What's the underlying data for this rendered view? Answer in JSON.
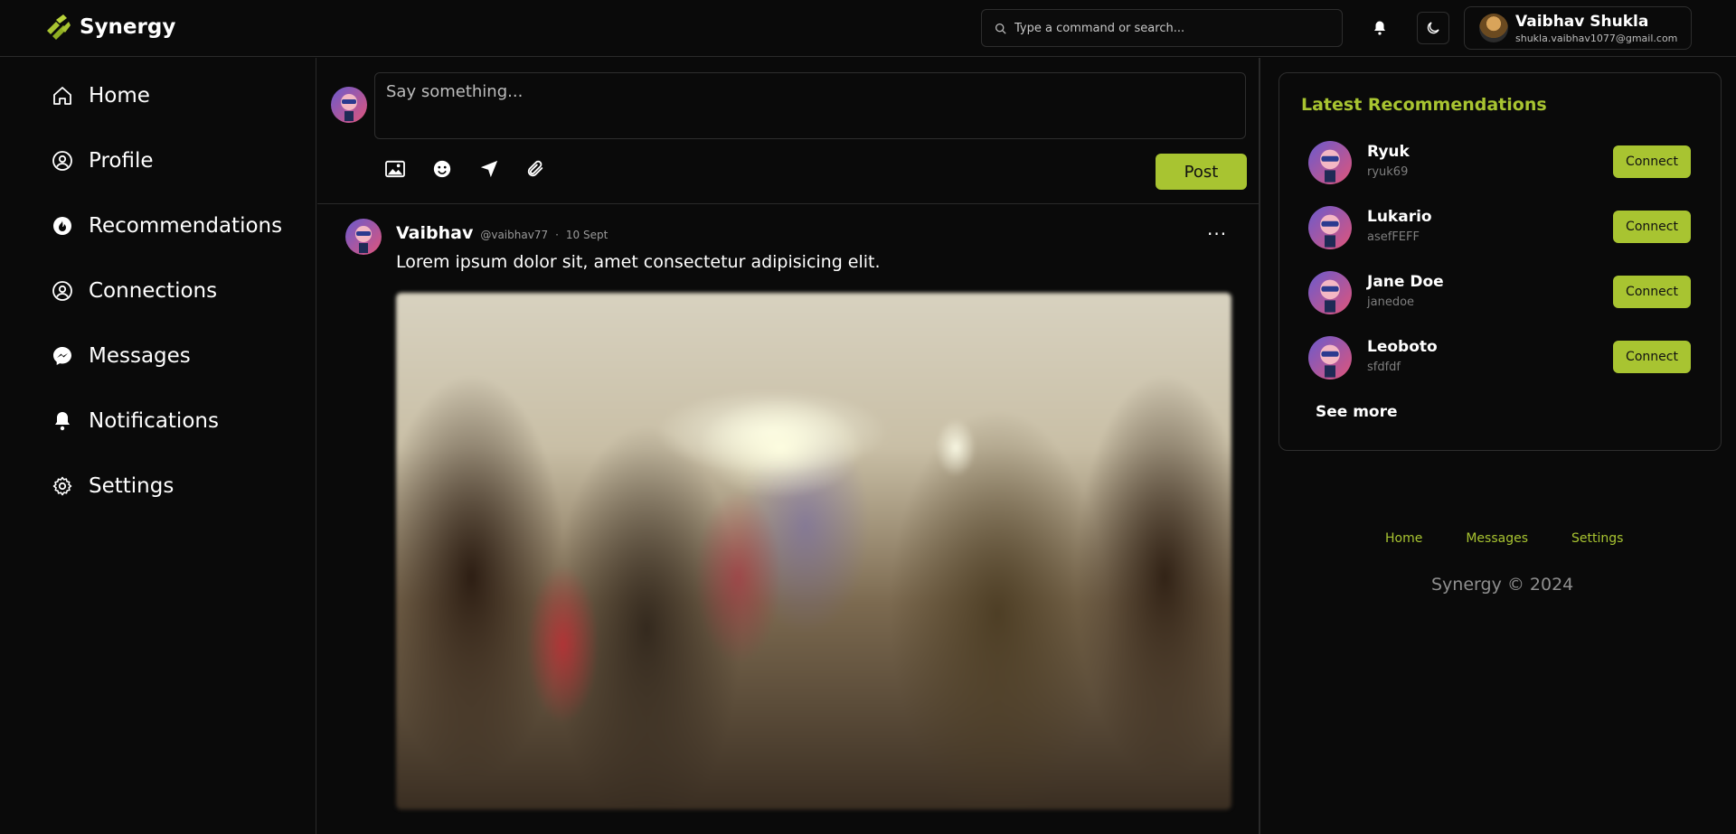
{
  "header": {
    "brand": "Synergy",
    "search_placeholder": "Type a command or search...",
    "user": {
      "name": "Vaibhav Shukla",
      "email": "shukla.vaibhav1077@gmail.com"
    }
  },
  "sidebar": {
    "items": [
      {
        "label": "Home",
        "icon": "home-icon"
      },
      {
        "label": "Profile",
        "icon": "user-circle-icon"
      },
      {
        "label": "Recommendations",
        "icon": "fire-icon"
      },
      {
        "label": "Connections",
        "icon": "user-circle-icon"
      },
      {
        "label": "Messages",
        "icon": "messenger-icon"
      },
      {
        "label": "Notifications",
        "icon": "bell-icon"
      },
      {
        "label": "Settings",
        "icon": "gear-icon"
      }
    ]
  },
  "composer": {
    "placeholder": "Say something...",
    "post_label": "Post",
    "tools": [
      "image-icon",
      "emoji-icon",
      "location-icon",
      "attachment-icon"
    ]
  },
  "post": {
    "author": "Vaibhav",
    "handle": "@vaibhav77",
    "separator": "·",
    "date": "10 Sept",
    "menu": "···",
    "text": "Lorem ipsum dolor sit, amet consectetur adipisicing elit."
  },
  "recommendations": {
    "title": "Latest Recommendations",
    "connect_label": "Connect",
    "see_more": "See more",
    "items": [
      {
        "name": "Ryuk",
        "handle": "ryuk69"
      },
      {
        "name": "Lukario",
        "handle": "asefFEFF"
      },
      {
        "name": "Jane Doe",
        "handle": "janedoe"
      },
      {
        "name": "Leoboto",
        "handle": "sfdfdf"
      }
    ]
  },
  "footer": {
    "links": [
      "Home",
      "Messages",
      "Settings"
    ],
    "copyright": "Synergy © 2024"
  },
  "colors": {
    "accent": "#a8c431",
    "background": "#0a0a0a",
    "border": "#2a2a2a"
  }
}
